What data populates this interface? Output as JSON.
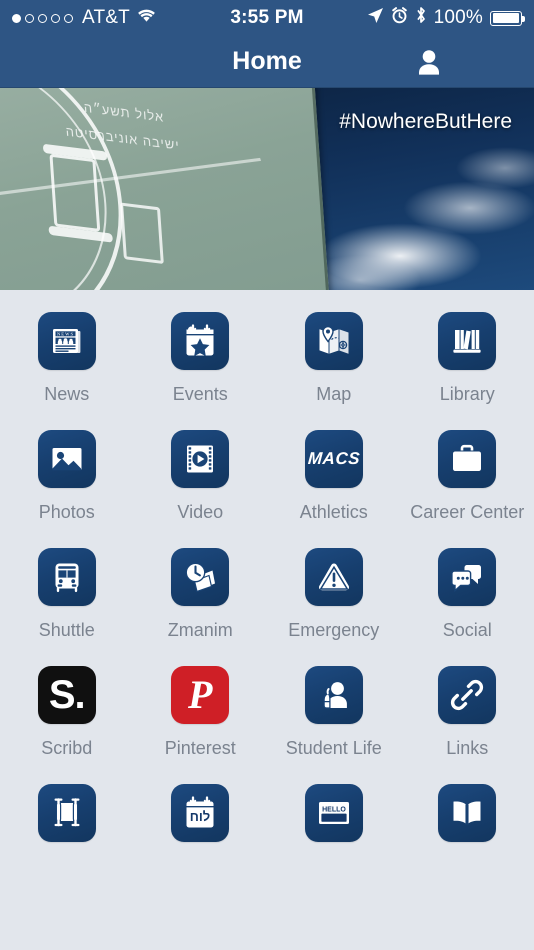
{
  "status_bar": {
    "signal_dots_total": 5,
    "signal_dots_filled": 1,
    "carrier": "AT&T",
    "wifi_icon": "wifi-icon",
    "time": "3:55 PM",
    "location_icon": "location-arrow-icon",
    "alarm_icon": "alarm-clock-icon",
    "bluetooth_icon": "bluetooth-icon",
    "battery_percent": "100%",
    "battery_icon": "battery-full-icon"
  },
  "navbar": {
    "title": "Home",
    "profile_icon": "person-icon",
    "menu_icon": "hamburger-menu-icon"
  },
  "hero": {
    "hashtag": "#NowhereButHere",
    "image_description": "university-seal-banner-against-sky",
    "hebrew_lines": [
      "אלול תשע״ה",
      "ישיבה אוניברסיטה"
    ]
  },
  "theme": {
    "navbar_color": "#2e5584",
    "tile_color": "#1a4476",
    "background_color": "#e2e6ec",
    "label_color": "#7b838f",
    "scribd_color": "#101010",
    "pinterest_color": "#cf1f26"
  },
  "grid": {
    "items": [
      {
        "label": "News",
        "icon": "newspaper-icon",
        "tile": "blue"
      },
      {
        "label": "Events",
        "icon": "calendar-star-icon",
        "tile": "blue"
      },
      {
        "label": "Map",
        "icon": "map-pin-icon",
        "tile": "blue"
      },
      {
        "label": "Library",
        "icon": "books-shelf-icon",
        "tile": "blue"
      },
      {
        "label": "Photos",
        "icon": "photo-icon",
        "tile": "blue"
      },
      {
        "label": "Video",
        "icon": "film-play-icon",
        "tile": "blue"
      },
      {
        "label": "Athletics",
        "icon": "macs-logo-icon",
        "tile": "blue",
        "text": "MACS"
      },
      {
        "label": "Career Center",
        "icon": "briefcase-icon",
        "tile": "blue"
      },
      {
        "label": "Shuttle",
        "icon": "bus-icon",
        "tile": "blue"
      },
      {
        "label": "Zmanim",
        "icon": "clock-pages-icon",
        "tile": "blue"
      },
      {
        "label": "Emergency",
        "icon": "warning-triangle-icon",
        "tile": "blue"
      },
      {
        "label": "Social",
        "icon": "chat-bubbles-icon",
        "tile": "blue"
      },
      {
        "label": "Scribd",
        "icon": "scribd-logo-icon",
        "tile": "black",
        "text": "S."
      },
      {
        "label": "Pinterest",
        "icon": "pinterest-logo-icon",
        "tile": "red",
        "text": "P"
      },
      {
        "label": "Student Life",
        "icon": "student-backpack-icon",
        "tile": "blue"
      },
      {
        "label": "Links",
        "icon": "chain-link-icon",
        "tile": "blue"
      },
      {
        "label": "",
        "icon": "torah-scroll-icon",
        "tile": "blue"
      },
      {
        "label": "",
        "icon": "luach-calendar-icon",
        "tile": "blue",
        "text": "לוח"
      },
      {
        "label": "",
        "icon": "name-badge-icon",
        "tile": "blue",
        "text": "HELLO"
      },
      {
        "label": "",
        "icon": "open-book-icon",
        "tile": "blue"
      }
    ]
  }
}
